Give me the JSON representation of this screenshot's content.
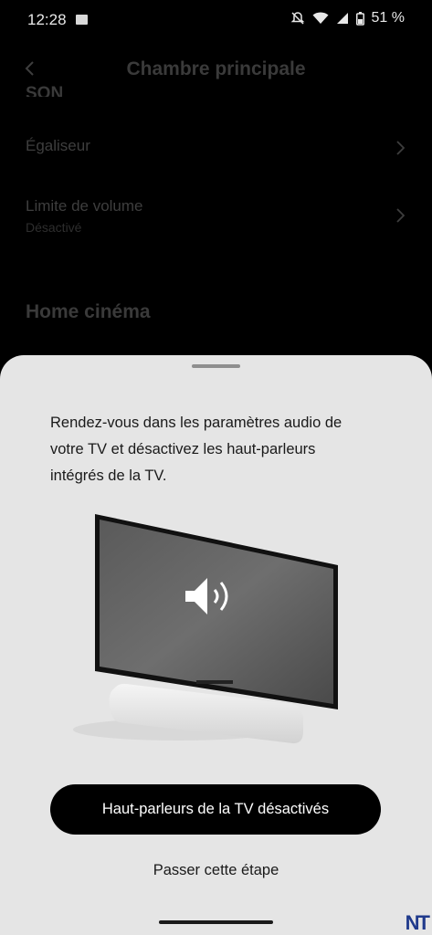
{
  "status_bar": {
    "time": "12:28",
    "battery": "51 %"
  },
  "page": {
    "title": "Chambre principale",
    "section_son": "SON",
    "rows": [
      {
        "label": "Égaliseur",
        "sub": ""
      },
      {
        "label": "Limite de volume",
        "sub": "Désactivé"
      }
    ],
    "section_home": "Home cinéma"
  },
  "sheet": {
    "instruction": "Rendez-vous dans les paramètres audio de votre TV et désactivez les haut-parleurs intégrés de la TV.",
    "primary_button": "Haut-parleurs de la TV désactivés",
    "skip_link": "Passer cette étape"
  },
  "watermark": "NT"
}
